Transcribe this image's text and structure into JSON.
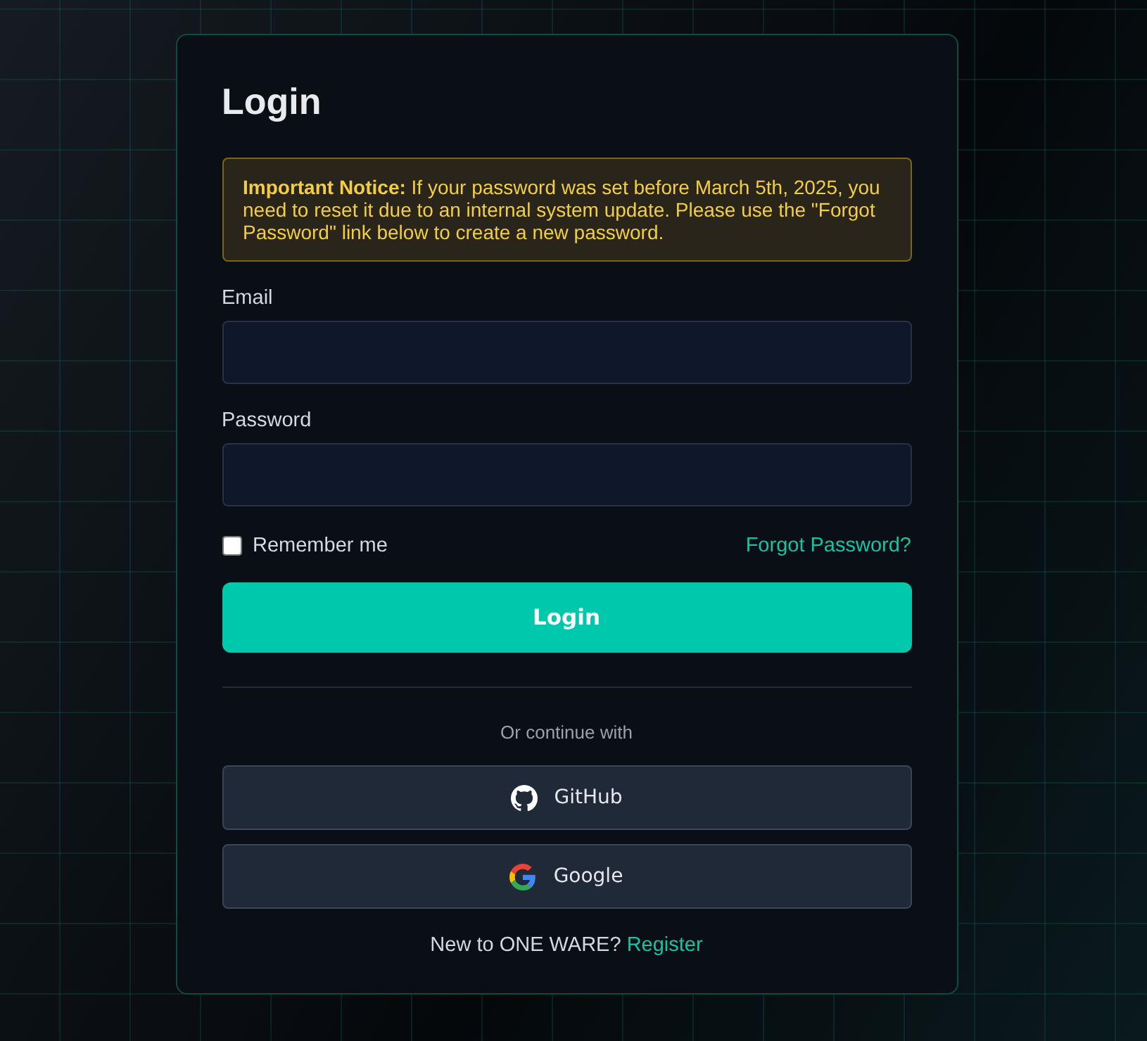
{
  "title": "Login",
  "notice": "**Important Notice:** If your password was set before March 5th, 2025, you need to reset it due to an internal system update. Please use the \"Forgot Password\" link below to create a new password.",
  "fields": [
    {
      "label": "Email"
    },
    {
      "label": "Password"
    }
  ],
  "remember": {
    "label": "Remember me",
    "checked": false
  },
  "forgot_link": "Forgot Password?",
  "submit": "Login",
  "divider_text": "Or continue with",
  "providers": [
    {
      "kind": "github",
      "label": "GitHub"
    },
    {
      "kind": "google",
      "label": "Google"
    }
  ],
  "register": {
    "prompt": "New to ONE WARE?",
    "link": "Register"
  }
}
